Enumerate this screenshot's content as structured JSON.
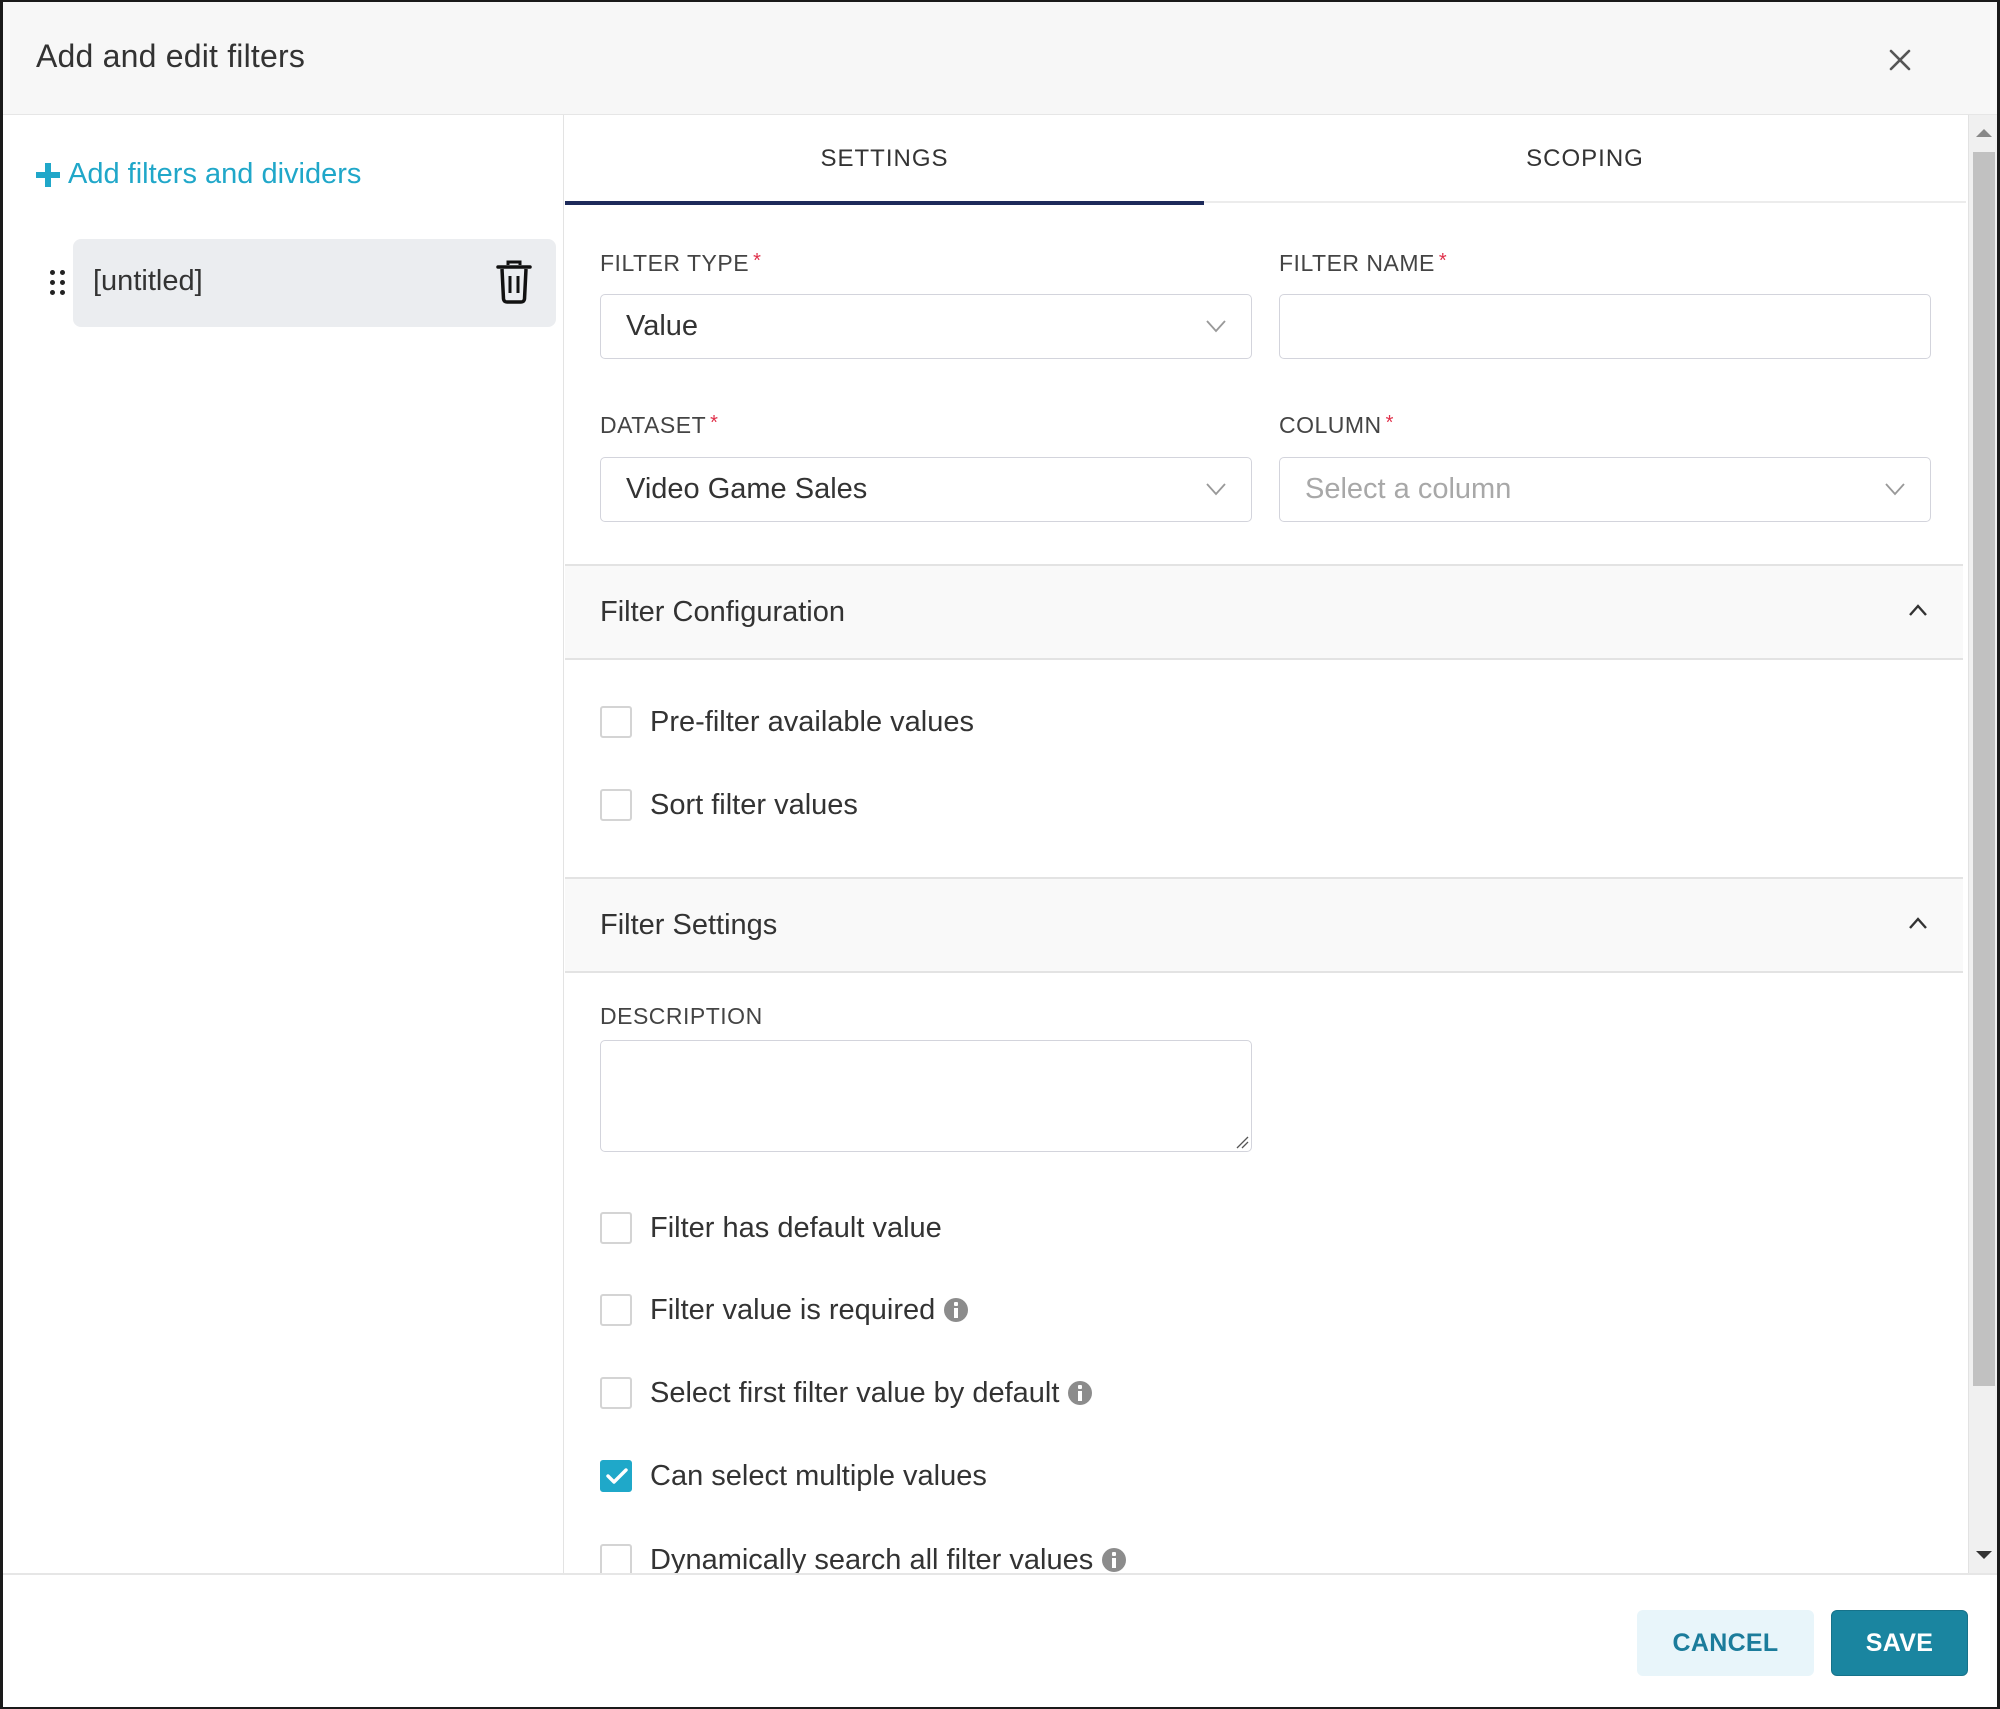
{
  "dialog": {
    "title": "Add and edit filters",
    "close_icon": "close-icon"
  },
  "sidebar": {
    "add_link_label": "Add filters and dividers",
    "items": [
      {
        "label": "[untitled]",
        "selected": true
      }
    ]
  },
  "tabs": [
    {
      "label": "SETTINGS",
      "active": true
    },
    {
      "label": "SCOPING",
      "active": false
    }
  ],
  "fields": {
    "filter_type": {
      "label": "FILTER TYPE",
      "required_mark": "*",
      "value": "Value"
    },
    "filter_name": {
      "label": "FILTER NAME",
      "required_mark": "*",
      "value": ""
    },
    "dataset": {
      "label": "DATASET",
      "required_mark": "*",
      "value": "Video Game Sales"
    },
    "column": {
      "label": "COLUMN",
      "required_mark": "*",
      "value": "",
      "placeholder": "Select a column"
    }
  },
  "sections": {
    "filter_configuration": {
      "title": "Filter Configuration",
      "expanded": true,
      "options": [
        {
          "label": "Pre-filter available values",
          "checked": false,
          "info": false
        },
        {
          "label": "Sort filter values",
          "checked": false,
          "info": false
        }
      ]
    },
    "filter_settings": {
      "title": "Filter Settings",
      "expanded": true,
      "description_label": "DESCRIPTION",
      "description_value": "",
      "options": [
        {
          "label": "Filter has default value",
          "checked": false,
          "info": false
        },
        {
          "label": "Filter value is required",
          "checked": false,
          "info": true
        },
        {
          "label": "Select first filter value by default",
          "checked": false,
          "info": true
        },
        {
          "label": "Can select multiple values",
          "checked": true,
          "info": false
        },
        {
          "label": "Dynamically search all filter values",
          "checked": false,
          "info": true
        }
      ]
    }
  },
  "footer": {
    "cancel_label": "CANCEL",
    "save_label": "SAVE"
  },
  "colors": {
    "accent": "#20a7c9",
    "tab_indicator": "#1d2a5a",
    "required": "#e0304a",
    "checkbox_checked": "#1fa8c9",
    "save_button": "#1a85a0",
    "cancel_button_bg": "#e8f5fa"
  }
}
